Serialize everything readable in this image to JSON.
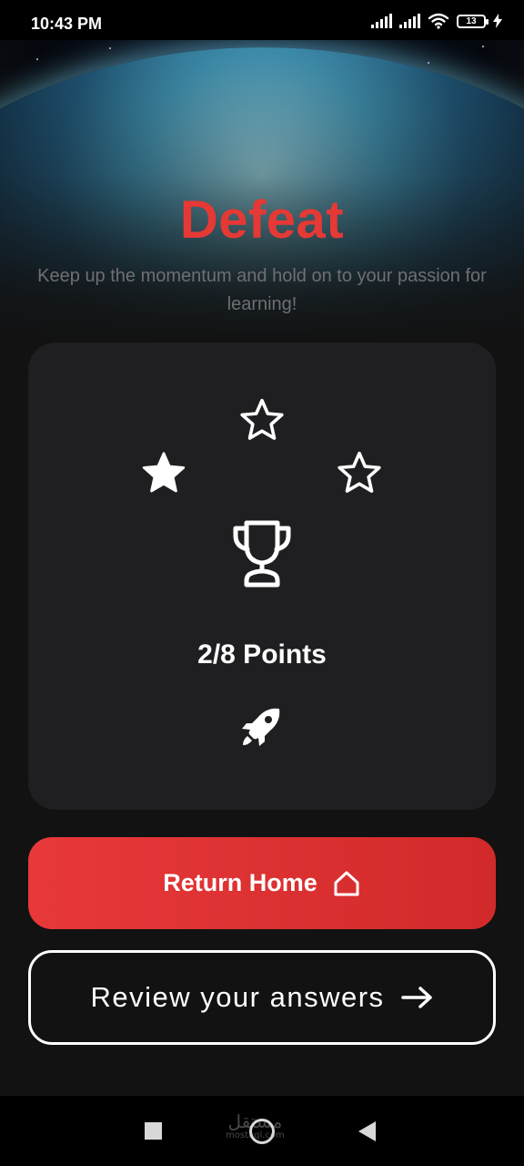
{
  "status_bar": {
    "time": "10:43 PM",
    "battery": "13",
    "icons": [
      "signal-icon",
      "signal-icon",
      "wifi-icon",
      "battery-icon",
      "charging-icon"
    ]
  },
  "result": {
    "title": "Defeat",
    "message": "Keep up the momentum and hold on to your passion for learning!",
    "stars_earned": 1,
    "stars_total": 3,
    "points": "2/8 Points"
  },
  "buttons": {
    "return_home": "Return Home",
    "review_answers": "Review your answers"
  },
  "watermark": {
    "main": "مستقل",
    "sub": "mostaql.com"
  },
  "colors": {
    "accent": "#e53935",
    "background": "#121212",
    "card": "#1f1f22",
    "subtitle": "#6f6f73"
  },
  "nav_bar": {
    "icons": [
      "recents-icon",
      "home-icon",
      "back-icon"
    ]
  }
}
